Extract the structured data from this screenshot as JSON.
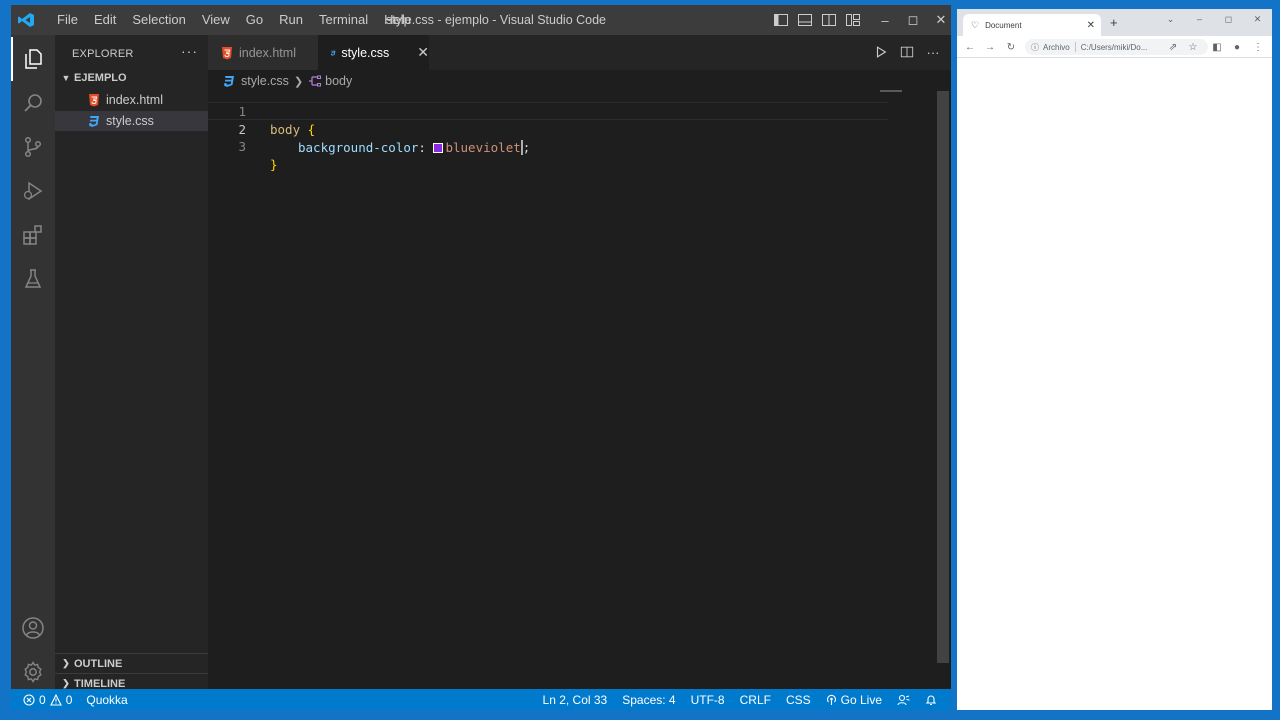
{
  "vscode": {
    "menu": [
      "File",
      "Edit",
      "Selection",
      "View",
      "Go",
      "Run",
      "Terminal",
      "Help"
    ],
    "window_title": "style.css - ejemplo - Visual Studio Code",
    "colors": {
      "accent": "#007acc",
      "editor_bg": "#1e1e1e",
      "sidebar_bg": "#252526",
      "activity_bg": "#333333",
      "title_bg": "#3c3c3c"
    },
    "activity_icons": [
      "explorer-icon",
      "search-icon",
      "source-control-icon",
      "run-debug-icon",
      "extensions-icon",
      "testing-icon",
      "account-icon",
      "settings-gear-icon"
    ],
    "sidebar": {
      "title": "EXPLORER",
      "more": "···",
      "folder": "EJEMPLO",
      "files": [
        {
          "name": "index.html",
          "icon": "html-file-icon"
        },
        {
          "name": "style.css",
          "icon": "css-file-icon",
          "selected": true
        }
      ],
      "panels": [
        "OUTLINE",
        "TIMELINE"
      ]
    },
    "tabs": [
      {
        "label": "index.html",
        "icon": "html-file-icon",
        "active": false
      },
      {
        "label": "style.css",
        "icon": "css-file-icon",
        "active": true,
        "close": "✕"
      }
    ],
    "breadcrumbs": {
      "file": "style.css",
      "symbol": "body"
    },
    "code": {
      "line_numbers": [
        "1",
        "2",
        "3"
      ],
      "active_line": 2,
      "lines": [
        {
          "selector": "body",
          "open": "{"
        },
        {
          "property": "background-color",
          "colon": ":",
          "value": "blueviolet",
          "semicolon": ";",
          "swatch_color": "#8a2be2"
        },
        {
          "close": "}"
        }
      ]
    },
    "status": {
      "errors": "0",
      "warnings": "0",
      "quokka": "Quokka",
      "position": "Ln 2, Col 33",
      "spaces": "Spaces: 4",
      "encoding": "UTF-8",
      "eol": "CRLF",
      "language": "CSS",
      "golive": "Go Live"
    }
  },
  "browser": {
    "tab_title": "Document",
    "new_tab": "+",
    "address_label": "Archivo",
    "address_url": "C:/Users/miki/Do..."
  }
}
